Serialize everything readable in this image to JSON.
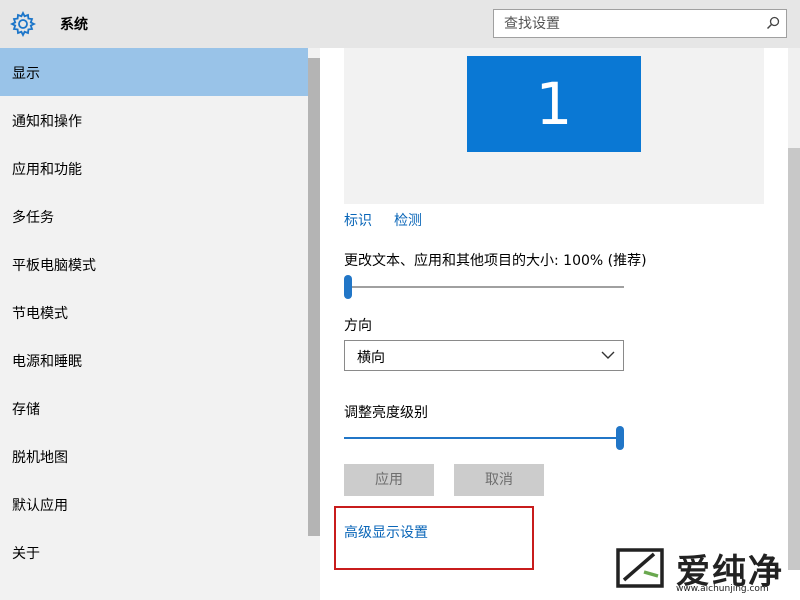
{
  "header": {
    "title": "系统",
    "search_placeholder": "查找设置"
  },
  "sidebar": {
    "items": [
      {
        "label": "显示",
        "active": true
      },
      {
        "label": "通知和操作"
      },
      {
        "label": "应用和功能"
      },
      {
        "label": "多任务"
      },
      {
        "label": "平板电脑模式"
      },
      {
        "label": "节电模式"
      },
      {
        "label": "电源和睡眠"
      },
      {
        "label": "存储"
      },
      {
        "label": "脱机地图"
      },
      {
        "label": "默认应用"
      },
      {
        "label": "关于"
      }
    ]
  },
  "main": {
    "monitor_number": "1",
    "identify_link": "标识",
    "detect_link": "检测",
    "scale_label": "更改文本、应用和其他项目的大小: 100% (推荐)",
    "scale_level": 0.0,
    "orientation_label": "方向",
    "orientation_value": "横向",
    "brightness_label": "调整亮度级别",
    "brightness_level": 1.0,
    "apply_button": "应用",
    "cancel_button": "取消",
    "advanced_link": "高级显示设置"
  },
  "watermark": {
    "text": "爱纯净",
    "url": "www.aichunjing.com"
  },
  "colors": {
    "accent": "#0a78d4",
    "link": "#0a66b8",
    "selected_nav": "#99c3e8",
    "highlight_box": "#c81c1c"
  },
  "icons": {
    "app": "gear-icon",
    "search": "search-icon",
    "dropdown": "chevron-down-icon"
  }
}
